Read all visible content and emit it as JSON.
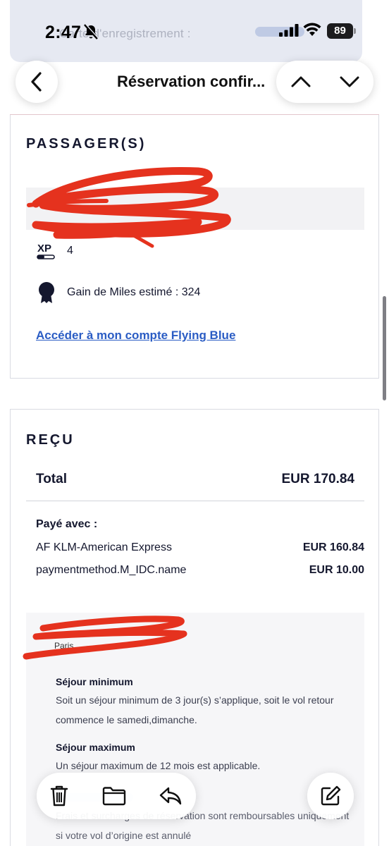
{
  "status_bar": {
    "time": "2:47",
    "battery": "89",
    "icons": [
      "bell-slash-icon",
      "cellular-signal-icon",
      "wifi-icon",
      "battery-icon"
    ]
  },
  "email_header_ghost": {
    "text": "Carte d'enregistrement :"
  },
  "nav": {
    "title": "Réservation confir...",
    "icons": [
      "chevron-left-icon",
      "chevron-up-icon",
      "chevron-down-icon"
    ]
  },
  "passengers": {
    "title": "PASSAGER(S)",
    "xp_value": "4",
    "xp_icon_label": "XP",
    "miles_text": "Gain de Miles estimé : 324",
    "flying_blue_link": "Accéder à mon compte Flying Blue"
  },
  "receipt": {
    "title": "REÇU",
    "total_label": "Total",
    "total_value": "EUR 170.84",
    "paid_with_label": "Payé avec :",
    "payments": [
      {
        "method": "AF KLM-American Express",
        "amount": "EUR 160.84"
      },
      {
        "method": "paymentmethod.M_IDC.name",
        "amount": "EUR 10.00"
      }
    ],
    "conditions": {
      "origin_ghost": "Paris",
      "min_stay_title": "Séjour minimum",
      "min_stay_text": "Soit un séjour minimum de 3 jour(s) s’applique, soit le vol retour commence le samedi,dimanche.",
      "max_stay_title": "Séjour maximum",
      "max_stay_text": "Un séjour maximum de 12 mois est applicable.",
      "refund_text": "Frais et surcharges de réservation sont remboursables uniquement si votre vol d’origine est annulé"
    }
  },
  "toolbar": {
    "icons": [
      "trash-icon",
      "folder-icon",
      "reply-icon",
      "compose-icon"
    ]
  },
  "colors": {
    "link": "#2a5cc4",
    "text": "#14172e",
    "redaction": "#e5321e"
  }
}
